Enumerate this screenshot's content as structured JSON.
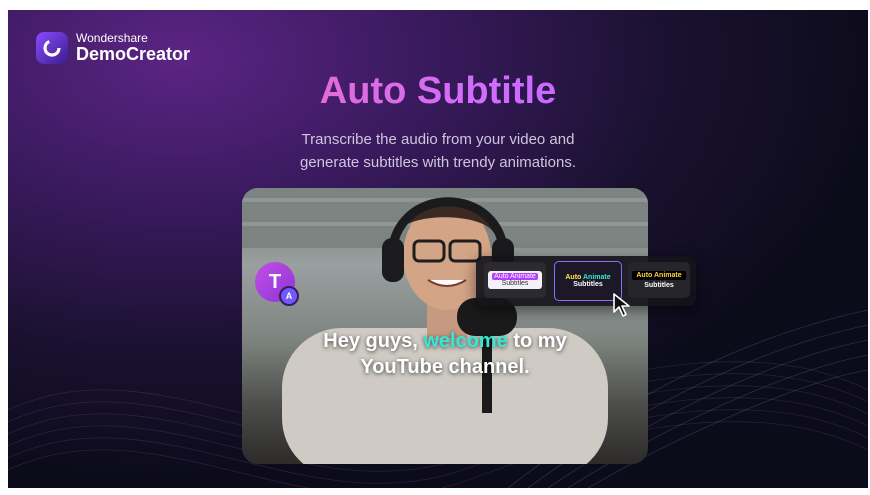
{
  "brand": {
    "company": "Wondershare",
    "product": "DemoCreator"
  },
  "hero": {
    "title": "Auto Subtitle",
    "description_line1": "Transcribe the audio from your video and",
    "description_line2": "generate subtitles with trendy animations."
  },
  "video": {
    "caption_part1": "Hey guys, ",
    "caption_highlight": "welcome",
    "caption_part2": " to my",
    "caption_line2": "YouTube channel."
  },
  "subtitle_badge": {
    "glyph": "T",
    "mini": "A"
  },
  "style_presets": [
    {
      "line1": "Auto Animate",
      "line2": "Subtitles"
    },
    {
      "line1_a": "Auto ",
      "line1_b": "Animate",
      "line2": "Subtitles"
    },
    {
      "line1": "Auto Animate",
      "line2": "Subtitles"
    }
  ],
  "colors": {
    "accent_cyan": "#39e6d2",
    "title_pink": "#ff6b8a",
    "title_purple": "#9a63ff"
  }
}
